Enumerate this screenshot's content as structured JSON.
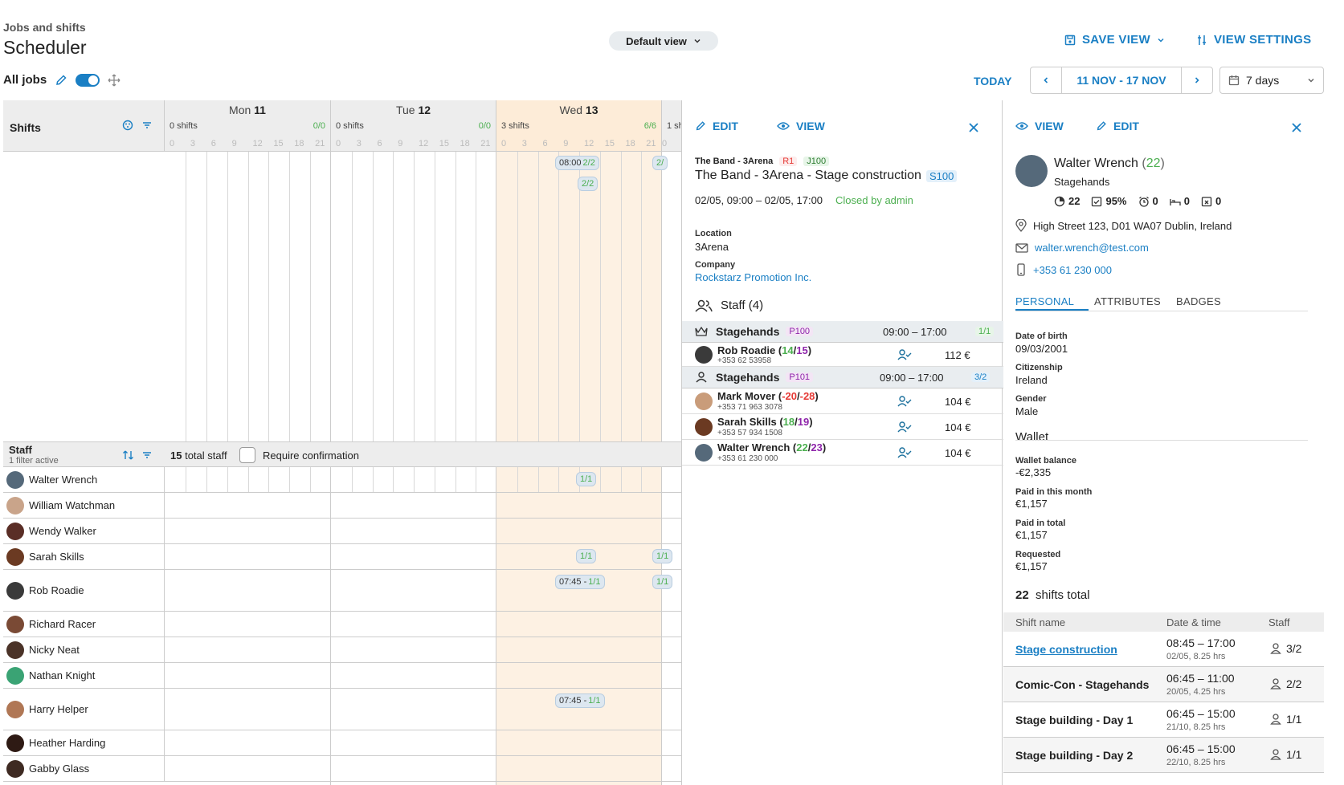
{
  "header": {
    "subtitle": "Jobs and shifts",
    "title": "Scheduler",
    "view_select": "Default view",
    "save_view": "SAVE VIEW",
    "view_settings": "VIEW SETTINGS",
    "all_jobs": "All jobs",
    "today": "TODAY",
    "date_range": "11 NOV - 17 NOV",
    "days_select": "7 days"
  },
  "scheduler": {
    "shifts_label": "Shifts",
    "days": [
      {
        "name": "Mon",
        "num": "11",
        "shifts": "0 shifts",
        "ratio": "0/0"
      },
      {
        "name": "Tue",
        "num": "12",
        "shifts": "0 shifts",
        "ratio": "0/0"
      },
      {
        "name": "Wed",
        "num": "13",
        "shifts": "3 shifts",
        "ratio": "6/6"
      },
      {
        "name": "",
        "num": "",
        "shifts": "1 sh",
        "ratio": ""
      }
    ],
    "hours": [
      "0",
      "3",
      "6",
      "9",
      "12",
      "15",
      "18",
      "21"
    ],
    "shift_chips": {
      "c1_time": "08:00",
      "c1_ratio": "2/2",
      "c2_ratio": "2/2",
      "c3_ratio": "2/"
    },
    "staff_label": "Staff",
    "staff_filter": "1 filter active",
    "total_staff_num": "15",
    "total_staff_text": "total staff",
    "require_confirmation": "Require confirmation",
    "staff": [
      {
        "name": "Walter Wrench"
      },
      {
        "name": "William Watchman"
      },
      {
        "name": "Wendy Walker"
      },
      {
        "name": "Sarah Skills"
      },
      {
        "name": "Rob Roadie"
      },
      {
        "name": "Richard Racer"
      },
      {
        "name": "Nicky Neat"
      },
      {
        "name": "Nathan Knight"
      },
      {
        "name": "Harry Helper"
      },
      {
        "name": "Heather Harding"
      },
      {
        "name": "Gabby Glass"
      }
    ],
    "staff_chips": {
      "walter": "1/1",
      "sarah_a": "1/1",
      "sarah_b": "1/1",
      "rob_time": "07:45 -",
      "rob_ratio": "1/1",
      "rob_b": "1/1",
      "harry_time": "07:45 -",
      "harry_ratio": "1/1"
    }
  },
  "shift_panel": {
    "edit": "EDIT",
    "view": "VIEW",
    "job_name": "The Band - 3Arena",
    "badge_r": "R1",
    "badge_j": "J100",
    "title": "The Band - 3Arena - Stage construction",
    "badge_s": "S100",
    "time": "02/05, 09:00 – 02/05, 17:00",
    "status": "Closed by admin",
    "location_label": "Location",
    "location": "3Arena",
    "company_label": "Company",
    "company": "Rockstarz Promotion Inc.",
    "staff_title": "Staff (4)",
    "groups": [
      {
        "name": "Stagehands",
        "code": "P100",
        "time": "09:00 – 17:00",
        "ratio": "1/1"
      },
      {
        "name": "Stagehands",
        "code": "P101",
        "time": "09:00 – 17:00",
        "ratio": "3/2"
      }
    ],
    "members": [
      {
        "name": "Rob Roadie",
        "a": "14",
        "b": "15",
        "phone": "+353 62 53958",
        "pay": "112 €"
      },
      {
        "name": "Mark Mover",
        "a": "-20",
        "b": "-28",
        "phone": "+353 71 963 3078",
        "pay": "104 €"
      },
      {
        "name": "Sarah Skills",
        "a": "18",
        "b": "19",
        "phone": "+353 57 934 1508",
        "pay": "104 €"
      },
      {
        "name": "Walter Wrench",
        "a": "22",
        "b": "23",
        "phone": "+353 61 230 000",
        "pay": "104 €"
      }
    ]
  },
  "staff_panel": {
    "view": "VIEW",
    "edit": "EDIT",
    "name": "Walter Wrench",
    "count": "22",
    "role": "Stagehands",
    "stats": {
      "shifts": "22",
      "confirm": "95%",
      "late": "0",
      "noshow": "0",
      "cancel": "0"
    },
    "address": "High Street 123, D01 WA07 Dublin, Ireland",
    "email": "walter.wrench@test.com",
    "phone": "+353 61 230 000",
    "tabs": [
      "PERSONAL",
      "ATTRIBUTES",
      "BADGES"
    ],
    "dob_label": "Date of birth",
    "dob": "09/03/2001",
    "citizenship_label": "Citizenship",
    "citizenship": "Ireland",
    "gender_label": "Gender",
    "gender": "Male",
    "wallet_title": "Wallet",
    "balance_label": "Wallet balance",
    "balance": "-€2,335",
    "paid_month_label": "Paid in this month",
    "paid_month": "€1,157",
    "paid_total_label": "Paid in total",
    "paid_total": "€1,157",
    "requested_label": "Requested",
    "requested": "€1,157",
    "shifts_total_num": "22",
    "shifts_total_text": "shifts total",
    "table_headers": [
      "Shift name",
      "Date & time",
      "Staff"
    ],
    "shifts": [
      {
        "name": "Stage construction",
        "time": "08:45 – 17:00",
        "date": "02/05, 8.25 hrs",
        "staff": "3/2"
      },
      {
        "name": "Comic-Con - Stagehands",
        "time": "06:45 – 11:00",
        "date": "20/05, 4.25 hrs",
        "staff": "2/2"
      },
      {
        "name": "Stage building - Day 1",
        "time": "06:45 – 15:00",
        "date": "21/10, 8.25 hrs",
        "staff": "1/1"
      },
      {
        "name": "Stage building - Day 2",
        "time": "06:45 – 15:00",
        "date": "22/10, 8.25 hrs",
        "staff": "1/1"
      }
    ]
  },
  "colors": {
    "accent": "#1a7fc4",
    "highlight_day": "#fdf1e3",
    "ok": "#4caf50",
    "warn": "#e53935",
    "purple": "#8e24aa"
  }
}
